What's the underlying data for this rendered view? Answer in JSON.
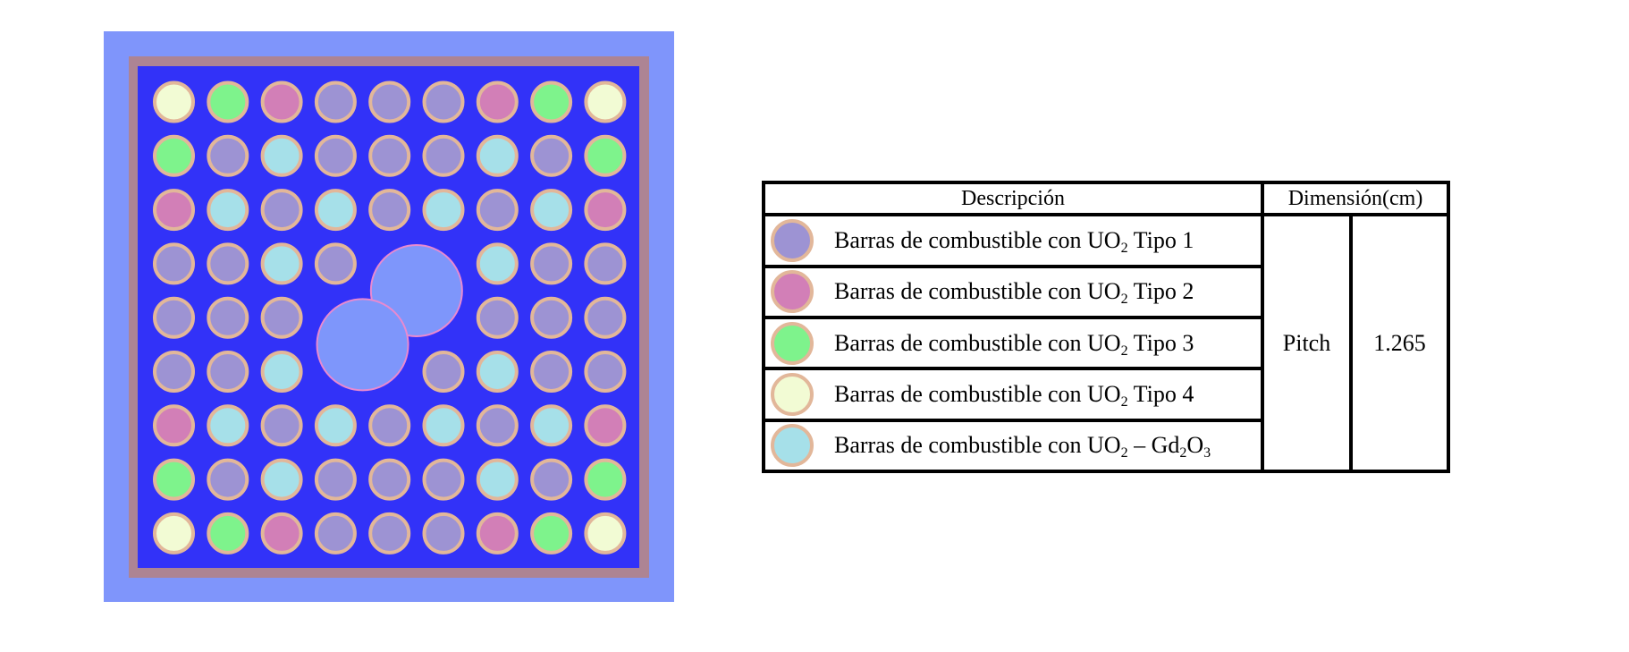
{
  "assembly": {
    "colors": {
      "reflector": "#7f95fb",
      "box_wall": "#ad8494",
      "coolant": "#3232f8",
      "cladding": "#e2b79a",
      "water_hole_fill": "#7e96fb",
      "water_hole_ring": "#e88ad0",
      "type1": "#9d93d3",
      "type2": "#d27fb7",
      "type3": "#7ef38c",
      "type4": "#f2fbd4",
      "gd": "#a6e0e9"
    },
    "lattice_size": 9,
    "layout_legend": "1=UO2 Tipo 1, 2=UO2 Tipo 2, 3=UO2 Tipo 3, 4=UO2 Tipo 4, G=UO2-Gd2O3, 0=empty/water hole region",
    "layout": [
      [
        "4",
        "3",
        "2",
        "1",
        "1",
        "1",
        "2",
        "3",
        "4"
      ],
      [
        "3",
        "1",
        "G",
        "1",
        "1",
        "1",
        "G",
        "1",
        "3"
      ],
      [
        "2",
        "G",
        "1",
        "G",
        "1",
        "G",
        "1",
        "G",
        "2"
      ],
      [
        "1",
        "1",
        "G",
        "1",
        "0",
        "0",
        "G",
        "1",
        "1"
      ],
      [
        "1",
        "1",
        "1",
        "0",
        "0",
        "0",
        "1",
        "1",
        "1"
      ],
      [
        "1",
        "1",
        "G",
        "0",
        "0",
        "1",
        "G",
        "1",
        "1"
      ],
      [
        "2",
        "G",
        "1",
        "G",
        "1",
        "G",
        "1",
        "G",
        "2"
      ],
      [
        "3",
        "1",
        "G",
        "1",
        "1",
        "1",
        "G",
        "1",
        "3"
      ],
      [
        "4",
        "3",
        "2",
        "1",
        "1",
        "1",
        "2",
        "3",
        "4"
      ]
    ],
    "water_holes": [
      {
        "name": "upper-water-rod",
        "row_center": 3.5,
        "col_center": 4.5
      },
      {
        "name": "lower-water-rod",
        "row_center": 4.5,
        "col_center": 3.5
      }
    ]
  },
  "table": {
    "header_description": "Descripción",
    "header_dimension": "Dimensión(cm)",
    "rows": [
      {
        "prefix": "Barras de combustible con UO",
        "sub": "2",
        "suffix": " Tipo 1",
        "color_key": "type1"
      },
      {
        "prefix": "Barras de combustible con UO",
        "sub": "2",
        "suffix": " Tipo 2",
        "color_key": "type2"
      },
      {
        "prefix": "Barras de combustible con UO",
        "sub": "2",
        "suffix": " Tipo 3",
        "color_key": "type3"
      },
      {
        "prefix": "Barras de combustible con UO",
        "sub": "2",
        "suffix": " Tipo 4",
        "color_key": "type4"
      },
      {
        "prefix": "Barras de combustible con UO",
        "sub": "2",
        "suffix": " – Gd",
        "sub2": "2",
        "suffix2": "O",
        "sub3": "3",
        "color_key": "gd"
      }
    ],
    "dimension_name": "Pitch",
    "dimension_value": "1.265"
  }
}
